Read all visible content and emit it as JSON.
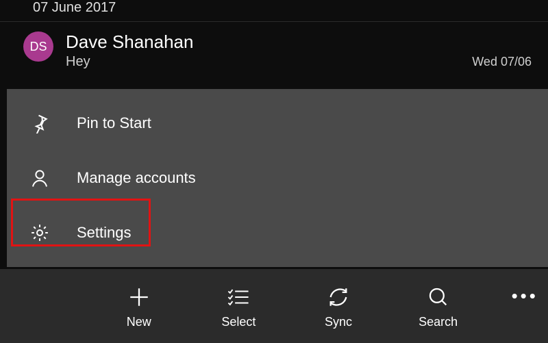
{
  "header": {
    "date": "07 June 2017"
  },
  "message": {
    "avatar_initials": "DS",
    "sender": "Dave Shanahan",
    "preview": "Hey",
    "date": "Wed 07/06"
  },
  "context_menu": {
    "items": [
      {
        "label": "Pin to Start"
      },
      {
        "label": "Manage accounts"
      },
      {
        "label": "Settings"
      }
    ]
  },
  "bottom_bar": {
    "new_label": "New",
    "select_label": "Select",
    "sync_label": "Sync",
    "search_label": "Search"
  },
  "colors": {
    "avatar_bg": "#a93a8f",
    "menu_bg": "#4a4a4a",
    "bar_bg": "#2b2b2b",
    "highlight": "#e11313"
  }
}
